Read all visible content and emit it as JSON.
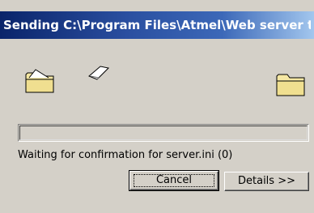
{
  "window": {
    "title": "Sending C:\\Program Files\\Atmel\\Web server t..."
  },
  "animation": {
    "source_icon": "folder-icon",
    "destination_icon": "folder-icon",
    "flying_item_icon": "paper-icon"
  },
  "progress": {
    "fraction": 0
  },
  "status": {
    "text": "Waiting for confirmation for server.ini (0)"
  },
  "buttons": {
    "cancel_label": "Cancel",
    "details_label": "Details >>"
  },
  "colors": {
    "titlebar_start": "#0a246a",
    "titlebar_end": "#a6caf0",
    "face": "#d4d0c8",
    "folder": "#f5e7a3"
  }
}
